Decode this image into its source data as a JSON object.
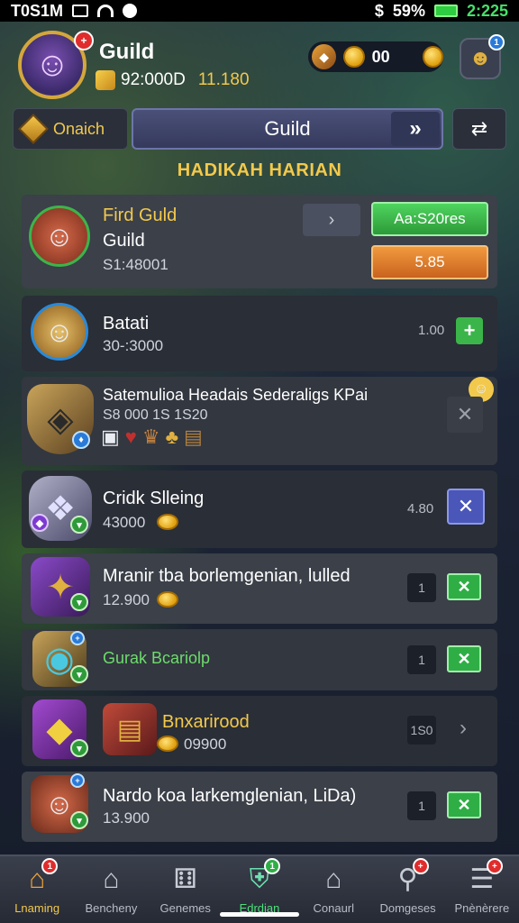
{
  "status": {
    "time_left": "T0S1M",
    "battery": "59%",
    "clock": "2:225"
  },
  "header": {
    "guild_label": "Guild",
    "stat_value": "92:000D",
    "stat_gold": "11.180",
    "currency_value": "00",
    "avatar_badge": "+",
    "settings_badge": "1"
  },
  "topnav": {
    "left_tab": "Onaich",
    "active_tab": "Guild"
  },
  "section_title": "HADIKAH HARIAN",
  "rows": [
    {
      "title": "Fird Guld",
      "subtitle": "Guild",
      "value": "S1:48001",
      "green_btn": "Aa:S20res",
      "orange_btn": "5.85"
    },
    {
      "title": "Batati",
      "value": "30-:3000",
      "count": "1.00",
      "action": "+"
    },
    {
      "title": "Satemulioa Headais Sederaligs KPai",
      "value": "S8 000 1S 1S20"
    },
    {
      "title": "Cridk Slleing",
      "value": "43000",
      "count": "4.80"
    },
    {
      "title": "Mranir tba borlemgenian, lulled",
      "value": "12.900",
      "count": "1"
    },
    {
      "title": "Gurak Bcariolp",
      "count": "1"
    },
    {
      "title": "Bnxarirood",
      "value": "09900",
      "count": "1S0"
    },
    {
      "title": "Nardo koa larkemglenian, LiDa)",
      "value": "13.900",
      "count": "1"
    }
  ],
  "icons": {
    "close": "✕",
    "plus": "+",
    "chevron_right": "›"
  },
  "bottomnav": [
    {
      "label": "Lnaming",
      "badge": "1"
    },
    {
      "label": "Bencheny",
      "badge": ""
    },
    {
      "label": "Genemes",
      "badge": ""
    },
    {
      "label": "Edrdian",
      "badge": "1"
    },
    {
      "label": "Conaurl",
      "badge": ""
    },
    {
      "label": "Domgeses",
      "badge": "+"
    },
    {
      "label": "Pnènèrere",
      "badge": "+"
    }
  ],
  "colors": {
    "accent_gold": "#f2c94c",
    "accent_green": "#3bb54a",
    "accent_orange": "#e07a2a",
    "tab_active": "#4a5078"
  }
}
